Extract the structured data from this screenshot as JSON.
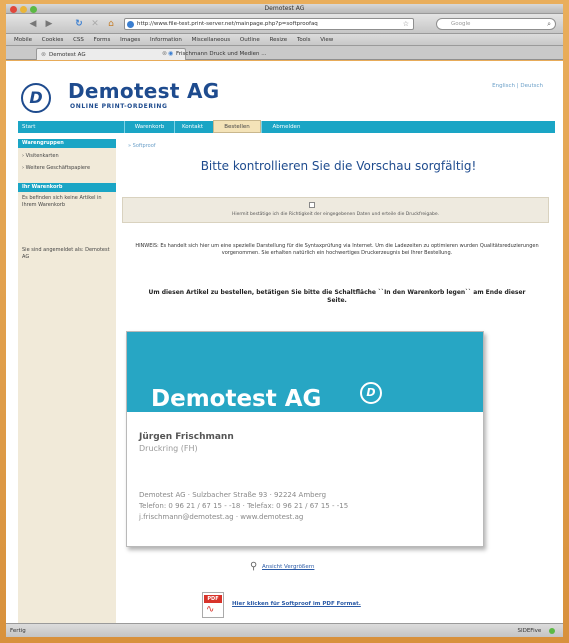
{
  "window": {
    "title": "Demotest AG"
  },
  "browser": {
    "url": "http://www.file-test.print-server.net/mainpage.php?p=softproofaq",
    "search_placeholder": "Google",
    "bookmarks": [
      "Mobile",
      "Cookies",
      "CSS",
      "Forms",
      "Images",
      "Information",
      "Miscellaneous",
      "Outline",
      "Resize",
      "Tools",
      "View"
    ],
    "tabs": [
      {
        "label": "Demotest AG"
      },
      {
        "label": "Frischmann Druck und Medien ..."
      }
    ],
    "status": "Fertig",
    "status_right": "SIDEFive"
  },
  "header": {
    "brand": "Demotest AG",
    "subtitle": "ONLINE PRINT-ORDERING",
    "lang_links": "Englisch | Deutsch"
  },
  "mainnav": {
    "home": "Start",
    "tabs": [
      "Warenkorb",
      "Kontakt",
      "Bestellen",
      "Abmelden"
    ]
  },
  "sidebar": {
    "section1_title": "Warengruppen",
    "item1": "› Visitenkarten",
    "item2": "› Weitere Geschäftspapiere",
    "section2_title": "Ihr Warenkorb",
    "cart_text": "Es befinden sich keine Artikel in Ihrem Warenkorb",
    "login_text": "Sie sind angemeldet als: Demotest AG"
  },
  "main": {
    "breadcrumb": "» Softproof",
    "title": "Bitte kontrollieren Sie die Vorschau sorgfältig!",
    "confirm_text": "Hiermit bestätige ich die Richtigkeit der eingegebenen Daten und erteile die Druckfreigabe.",
    "hint": "HINWEIS: Es handelt sich hier um eine spezielle Darstellung für die Syntaxprüfung via Internet. Um die Ladezeiten zu optimieren wurden Qualitätsreduzierungen vorgenommen. Sie erhalten natürlich ein hochwertiges Druckerzeugnis bei Ihrer Bestellung.",
    "order_notice": "Um diesen Artikel zu bestellen, betätigen Sie bitte die Schaltfläche ``In den Warenkorb legen`` am Ende dieser Seite.",
    "compare_link": "Ansicht Vergrößern",
    "pdf_badge": "PDF",
    "pdf_link": "Hier klicken für Softproof im PDF Format."
  },
  "card": {
    "brand": "Demotest AG",
    "name": "Jürgen Frischmann",
    "role": "Druckring (FH)",
    "address_line1": "Demotest AG · Sulzbacher Straße 93 · 92224 Amberg",
    "address_line2": "Telefon: 0 96 21 / 67 15 - -18 · Telefax: 0 96 21 / 67 15 - -15",
    "address_line3": "j.frischmann@demotest.ag · www.demotest.ag"
  },
  "colors": {
    "brand_blue": "#1e4b8e",
    "nav_teal": "#1aa5c5",
    "sidebar_beige": "#f1ead9"
  }
}
